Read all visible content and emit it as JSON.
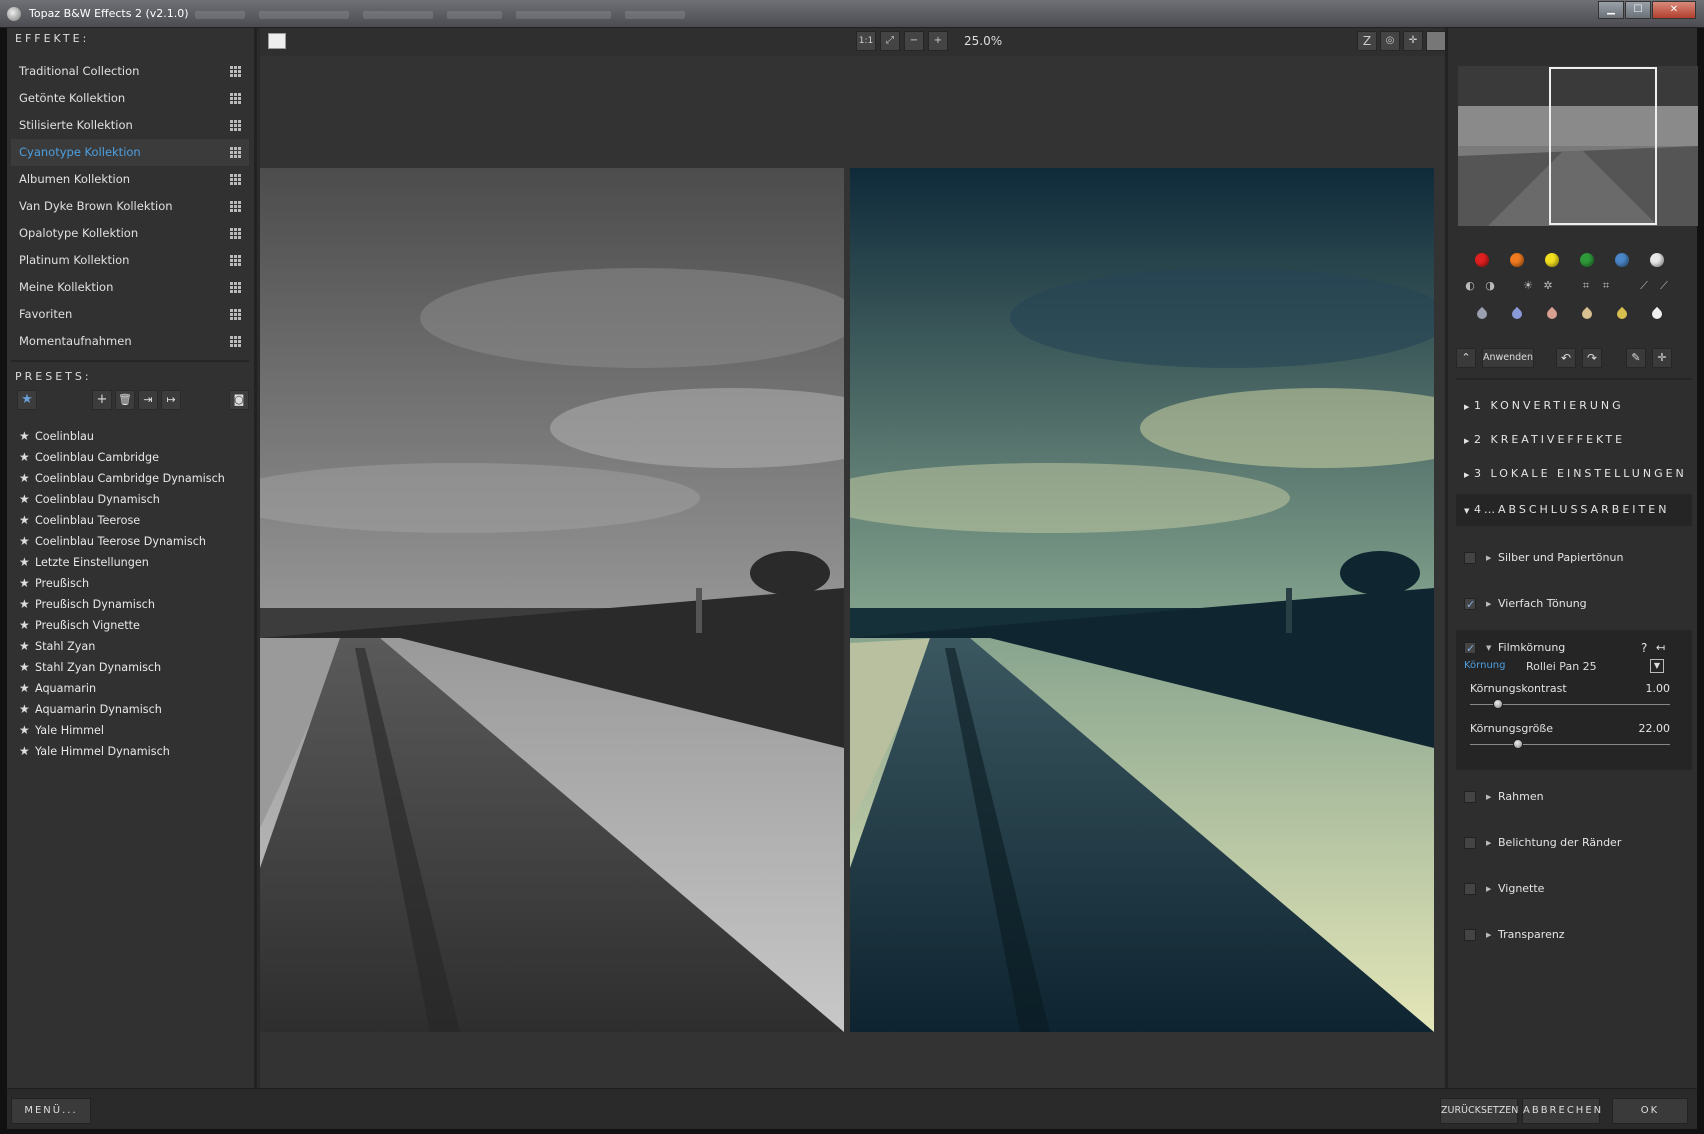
{
  "window": {
    "title": "Topaz B&W Effects 2 (v2.1.0)",
    "buttons": {
      "minimize": "▁",
      "maximize": "☐",
      "close": "✕"
    }
  },
  "effects": {
    "title": "EFFEKTE:",
    "items": [
      {
        "label": "Traditional Collection",
        "active": false
      },
      {
        "label": "Getönte Kollektion",
        "active": false
      },
      {
        "label": "Stilisierte Kollektion",
        "active": false
      },
      {
        "label": "Cyanotype Kollektion",
        "active": true
      },
      {
        "label": "Albumen Kollektion",
        "active": false
      },
      {
        "label": "Van Dyke Brown Kollektion",
        "active": false
      },
      {
        "label": "Opalotype Kollektion",
        "active": false
      },
      {
        "label": "Platinum Kollektion",
        "active": false
      },
      {
        "label": "Meine Kollektion",
        "active": false
      },
      {
        "label": "Favoriten",
        "active": false
      },
      {
        "label": "Momentaufnahmen",
        "active": false
      }
    ]
  },
  "presets": {
    "title": "PRESETS:",
    "items": [
      "Coelinblau",
      "Coelinblau Cambridge",
      "Coelinblau Cambridge Dynamisch",
      "Coelinblau Dynamisch",
      "Coelinblau Teerose",
      "Coelinblau Teerose Dynamisch",
      "Letzte Einstellungen",
      "Preußisch",
      "Preußisch Dynamisch",
      "Preußisch Vignette",
      "Stahl Zyan",
      "Stahl Zyan Dynamisch",
      "Aquamarin",
      "Aquamarin Dynamisch",
      "Yale Himmel",
      "Yale Himmel Dynamisch"
    ]
  },
  "toolbar": {
    "actual_size": "1:1",
    "zoom_value": "25.0%"
  },
  "right_panel": {
    "color_swatches": [
      "#e02020",
      "#f07a20",
      "#f2e020",
      "#2f9a3a",
      "#4a86c8",
      "#e8e8e8"
    ],
    "drop_colors": [
      "#9aa0b0",
      "#8a9ad8",
      "#d8a090",
      "#d8c090",
      "#d8c050",
      "#f0f0f0"
    ],
    "apply_label": "Anwenden",
    "sections": [
      {
        "label": "1 KONVERTIERUNG",
        "open": false
      },
      {
        "label": "2 KREATIVEFFEKTE",
        "open": false
      },
      {
        "label": "3 LOKALE EINSTELLUNGEN",
        "open": false
      },
      {
        "label": "4…ABSCHLUSSARBEITEN",
        "open": true
      }
    ],
    "finishing": {
      "silver": {
        "label": "Silber und Papiertönun",
        "checked": false
      },
      "quad": {
        "label": "Vierfach Tönung",
        "checked": true
      },
      "film": {
        "label": "Filmkörnung",
        "checked": true,
        "help": "?",
        "grain_label": "Körnung",
        "grain_value": "Rollei Pan 25",
        "contrast_label": "Körnungskontrast",
        "contrast_value": "1.00",
        "contrast_level": 0.14,
        "size_label": "Körnungsgröße",
        "size_value": "22.00",
        "size_level": 0.24
      },
      "frame": {
        "label": "Rahmen",
        "checked": false
      },
      "edge": {
        "label": "Belichtung der Ränder",
        "checked": false
      },
      "vignette": {
        "label": "Vignette",
        "checked": false
      },
      "transparency": {
        "label": "Transparenz",
        "checked": false
      }
    }
  },
  "bottom": {
    "menu_label": "MENÜ...",
    "reset_label": "ZURÜCKSETZEN",
    "cancel_label": "ABBRECHEN",
    "ok_label": "OK"
  }
}
